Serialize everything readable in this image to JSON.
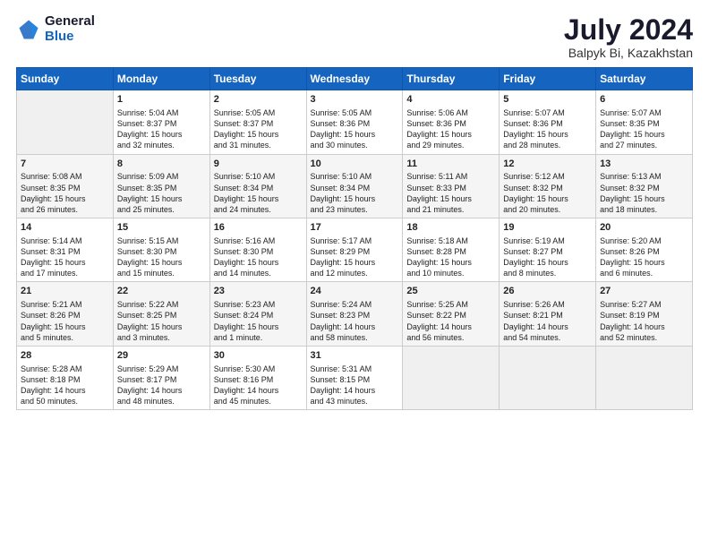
{
  "logo": {
    "general": "General",
    "blue": "Blue"
  },
  "title": {
    "month_year": "July 2024",
    "location": "Balpyk Bi, Kazakhstan"
  },
  "days_of_week": [
    "Sunday",
    "Monday",
    "Tuesday",
    "Wednesday",
    "Thursday",
    "Friday",
    "Saturday"
  ],
  "weeks": [
    [
      {
        "day": "",
        "content": ""
      },
      {
        "day": "1",
        "content": "Sunrise: 5:04 AM\nSunset: 8:37 PM\nDaylight: 15 hours\nand 32 minutes."
      },
      {
        "day": "2",
        "content": "Sunrise: 5:05 AM\nSunset: 8:37 PM\nDaylight: 15 hours\nand 31 minutes."
      },
      {
        "day": "3",
        "content": "Sunrise: 5:05 AM\nSunset: 8:36 PM\nDaylight: 15 hours\nand 30 minutes."
      },
      {
        "day": "4",
        "content": "Sunrise: 5:06 AM\nSunset: 8:36 PM\nDaylight: 15 hours\nand 29 minutes."
      },
      {
        "day": "5",
        "content": "Sunrise: 5:07 AM\nSunset: 8:36 PM\nDaylight: 15 hours\nand 28 minutes."
      },
      {
        "day": "6",
        "content": "Sunrise: 5:07 AM\nSunset: 8:35 PM\nDaylight: 15 hours\nand 27 minutes."
      }
    ],
    [
      {
        "day": "7",
        "content": "Sunrise: 5:08 AM\nSunset: 8:35 PM\nDaylight: 15 hours\nand 26 minutes."
      },
      {
        "day": "8",
        "content": "Sunrise: 5:09 AM\nSunset: 8:35 PM\nDaylight: 15 hours\nand 25 minutes."
      },
      {
        "day": "9",
        "content": "Sunrise: 5:10 AM\nSunset: 8:34 PM\nDaylight: 15 hours\nand 24 minutes."
      },
      {
        "day": "10",
        "content": "Sunrise: 5:10 AM\nSunset: 8:34 PM\nDaylight: 15 hours\nand 23 minutes."
      },
      {
        "day": "11",
        "content": "Sunrise: 5:11 AM\nSunset: 8:33 PM\nDaylight: 15 hours\nand 21 minutes."
      },
      {
        "day": "12",
        "content": "Sunrise: 5:12 AM\nSunset: 8:32 PM\nDaylight: 15 hours\nand 20 minutes."
      },
      {
        "day": "13",
        "content": "Sunrise: 5:13 AM\nSunset: 8:32 PM\nDaylight: 15 hours\nand 18 minutes."
      }
    ],
    [
      {
        "day": "14",
        "content": "Sunrise: 5:14 AM\nSunset: 8:31 PM\nDaylight: 15 hours\nand 17 minutes."
      },
      {
        "day": "15",
        "content": "Sunrise: 5:15 AM\nSunset: 8:30 PM\nDaylight: 15 hours\nand 15 minutes."
      },
      {
        "day": "16",
        "content": "Sunrise: 5:16 AM\nSunset: 8:30 PM\nDaylight: 15 hours\nand 14 minutes."
      },
      {
        "day": "17",
        "content": "Sunrise: 5:17 AM\nSunset: 8:29 PM\nDaylight: 15 hours\nand 12 minutes."
      },
      {
        "day": "18",
        "content": "Sunrise: 5:18 AM\nSunset: 8:28 PM\nDaylight: 15 hours\nand 10 minutes."
      },
      {
        "day": "19",
        "content": "Sunrise: 5:19 AM\nSunset: 8:27 PM\nDaylight: 15 hours\nand 8 minutes."
      },
      {
        "day": "20",
        "content": "Sunrise: 5:20 AM\nSunset: 8:26 PM\nDaylight: 15 hours\nand 6 minutes."
      }
    ],
    [
      {
        "day": "21",
        "content": "Sunrise: 5:21 AM\nSunset: 8:26 PM\nDaylight: 15 hours\nand 5 minutes."
      },
      {
        "day": "22",
        "content": "Sunrise: 5:22 AM\nSunset: 8:25 PM\nDaylight: 15 hours\nand 3 minutes."
      },
      {
        "day": "23",
        "content": "Sunrise: 5:23 AM\nSunset: 8:24 PM\nDaylight: 15 hours\nand 1 minute."
      },
      {
        "day": "24",
        "content": "Sunrise: 5:24 AM\nSunset: 8:23 PM\nDaylight: 14 hours\nand 58 minutes."
      },
      {
        "day": "25",
        "content": "Sunrise: 5:25 AM\nSunset: 8:22 PM\nDaylight: 14 hours\nand 56 minutes."
      },
      {
        "day": "26",
        "content": "Sunrise: 5:26 AM\nSunset: 8:21 PM\nDaylight: 14 hours\nand 54 minutes."
      },
      {
        "day": "27",
        "content": "Sunrise: 5:27 AM\nSunset: 8:19 PM\nDaylight: 14 hours\nand 52 minutes."
      }
    ],
    [
      {
        "day": "28",
        "content": "Sunrise: 5:28 AM\nSunset: 8:18 PM\nDaylight: 14 hours\nand 50 minutes."
      },
      {
        "day": "29",
        "content": "Sunrise: 5:29 AM\nSunset: 8:17 PM\nDaylight: 14 hours\nand 48 minutes."
      },
      {
        "day": "30",
        "content": "Sunrise: 5:30 AM\nSunset: 8:16 PM\nDaylight: 14 hours\nand 45 minutes."
      },
      {
        "day": "31",
        "content": "Sunrise: 5:31 AM\nSunset: 8:15 PM\nDaylight: 14 hours\nand 43 minutes."
      },
      {
        "day": "",
        "content": ""
      },
      {
        "day": "",
        "content": ""
      },
      {
        "day": "",
        "content": ""
      }
    ]
  ]
}
